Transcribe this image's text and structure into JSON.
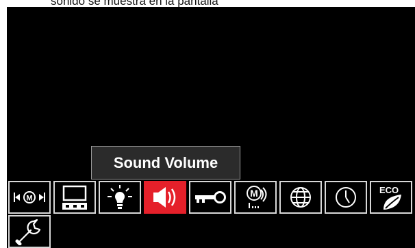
{
  "caption": {
    "text": "sonido se muestra en la pantalla"
  },
  "tooltip": {
    "label": "Sound Volume"
  },
  "menu": {
    "selected": "sound-volume",
    "icons": [
      "memory-recall-icon",
      "display-config-icon",
      "brightness-icon",
      "sound-volume-icon",
      "lock-key-icon",
      "memory-limits-icon",
      "language-globe-icon",
      "clock-icon",
      "eco-mode-icon",
      "service-wrench-icon"
    ],
    "eco_label": "ECO"
  },
  "colors": {
    "screen": "#000000",
    "selected_tile": "#e5202a",
    "tile_border": "#d8d8d8",
    "tooltip_bg": "#2b2b2b"
  }
}
